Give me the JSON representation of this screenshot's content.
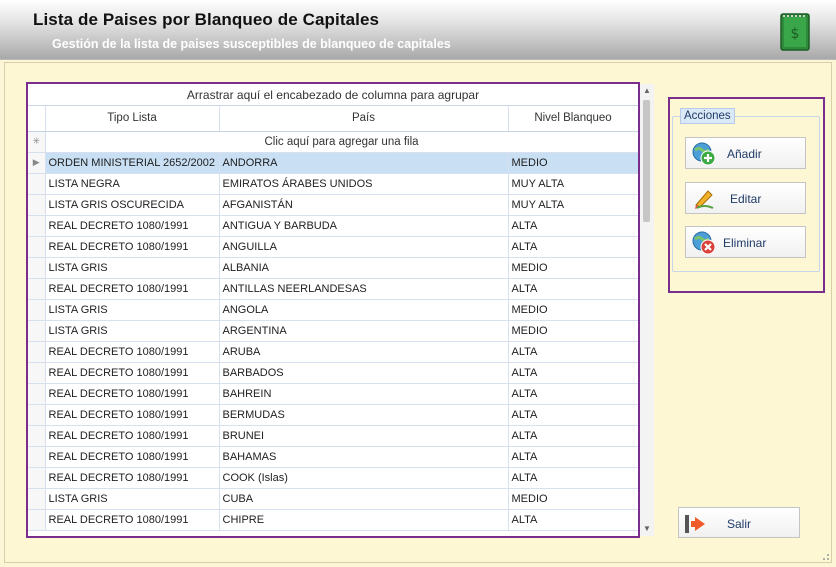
{
  "header": {
    "title": "Lista de Paises por Blanqueo de Capitales",
    "subtitle": "Gestión de la lista de paises susceptibles de blanqueo de capitales"
  },
  "grid": {
    "group_panel_text": "Arrastrar aquí el encabezado de columna para agrupar",
    "columns": [
      "Tipo Lista",
      "País",
      "Nivel Blanqueo"
    ],
    "new_row_text": "Clic aquí para agregar una fila",
    "rows": [
      [
        "ORDEN MINISTERIAL 2652/2002",
        "ANDORRA",
        "MEDIO"
      ],
      [
        "LISTA NEGRA",
        "EMIRATOS ÁRABES UNIDOS",
        "MUY ALTA"
      ],
      [
        "LISTA GRIS OSCURECIDA",
        "AFGANISTÁN",
        "MUY ALTA"
      ],
      [
        "REAL DECRETO 1080/1991",
        "ANTIGUA Y BARBUDA",
        "ALTA"
      ],
      [
        "REAL DECRETO 1080/1991",
        "ANGUILLA",
        "ALTA"
      ],
      [
        "LISTA GRIS",
        "ALBANIA",
        "MEDIO"
      ],
      [
        "REAL DECRETO 1080/1991",
        "ANTILLAS NEERLANDESAS",
        "ALTA"
      ],
      [
        "LISTA GRIS",
        "ANGOLA",
        "MEDIO"
      ],
      [
        "LISTA GRIS",
        "ARGENTINA",
        "MEDIO"
      ],
      [
        "REAL DECRETO 1080/1991",
        "ARUBA",
        "ALTA"
      ],
      [
        "REAL DECRETO 1080/1991",
        "BARBADOS",
        "ALTA"
      ],
      [
        "REAL DECRETO 1080/1991",
        "BAHREIN",
        "ALTA"
      ],
      [
        "REAL DECRETO 1080/1991",
        "BERMUDAS",
        "ALTA"
      ],
      [
        "REAL DECRETO 1080/1991",
        "BRUNEI",
        "ALTA"
      ],
      [
        "REAL DECRETO 1080/1991",
        "BAHAMAS",
        "ALTA"
      ],
      [
        "REAL DECRETO 1080/1991",
        "COOK (Islas)",
        "ALTA"
      ],
      [
        "LISTA GRIS",
        "CUBA",
        "MEDIO"
      ],
      [
        "REAL DECRETO 1080/1991",
        "CHIPRE",
        "ALTA"
      ]
    ]
  },
  "actions": {
    "group_label": "Acciones",
    "add_label": "Añadir",
    "edit_label": "Editar",
    "delete_label": "Eliminar",
    "exit_label": "Salir"
  },
  "colors": {
    "highlight_border": "#7b2d8e",
    "selected_row": "#c9dff3",
    "background": "#fdf6d6"
  }
}
